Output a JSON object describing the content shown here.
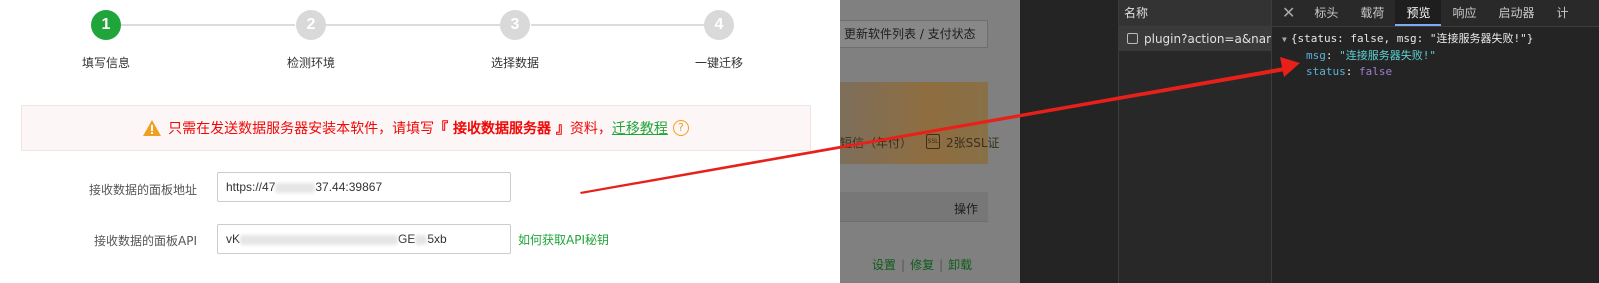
{
  "wizard": {
    "steps": [
      {
        "number": "1",
        "label": "填写信息",
        "active": true
      },
      {
        "number": "2",
        "label": "检测环境",
        "active": false
      },
      {
        "number": "3",
        "label": "选择数据",
        "active": false
      },
      {
        "number": "4",
        "label": "一键迁移",
        "active": false
      }
    ],
    "warning": {
      "text_before": "只需在发送数据服务器安装本软件，请填写",
      "bold_text": "『 接收数据服务器 』",
      "text_after": "资料，",
      "link_text": "迁移教程",
      "help_glyph": "?"
    },
    "fields": [
      {
        "label": "接收数据的面板地址",
        "value_start": "https://47",
        "value_mid": "37.4",
        "value_end": "4:39867"
      },
      {
        "label": "接收数据的面板API",
        "value_start": "vK",
        "value_end": "GE",
        "value_tail": "5xb"
      }
    ],
    "api_help_link": "如何获取API秘钥"
  },
  "background_page": {
    "update_button": "更新软件列表 / 支付状态",
    "banner_text_1": "短信（年付）",
    "ssl_badge": "SSL",
    "banner_text_2": "2张SSL证",
    "table_header": "操作",
    "row_actions": [
      "设置",
      "修复",
      "卸载"
    ]
  },
  "devtools": {
    "list_header": "名称",
    "request_name": "plugin?action=a&name=...",
    "tabs": [
      "标头",
      "载荷",
      "预览",
      "响应",
      "启动器",
      "计"
    ],
    "active_tab": "预览",
    "close_glyph": "✕",
    "preview": {
      "summary": "{status: false, msg: \"连接服务器失败!\"}",
      "msg_key": "msg",
      "msg_value": "\"连接服务器失败!\"",
      "status_key": "status",
      "status_value": "false"
    }
  },
  "colors": {
    "accent_green": "#20a53a",
    "warning_red": "#ef0808",
    "arrow_red": "#e8201a",
    "devtools_bg": "#242424"
  }
}
